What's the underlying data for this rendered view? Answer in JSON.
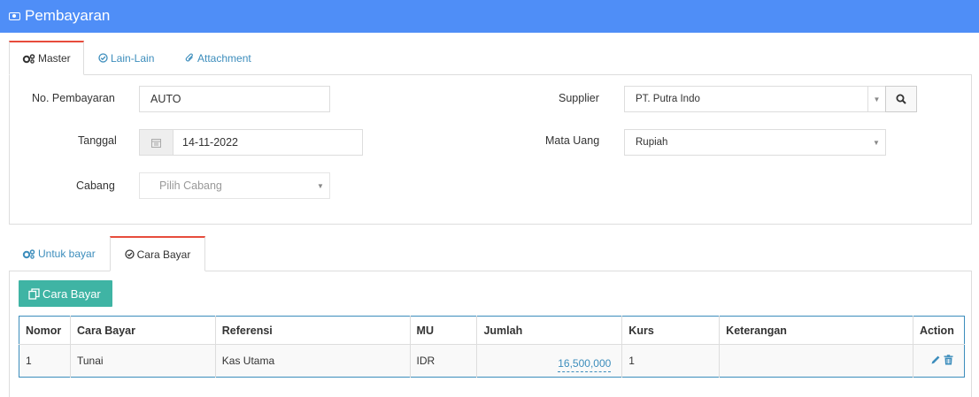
{
  "header": {
    "title": "Pembayaran",
    "icon": "money-icon"
  },
  "top_tabs": [
    {
      "label": "Master",
      "icon": "cogs-icon",
      "active": true
    },
    {
      "label": "Lain-Lain",
      "icon": "check-circle-icon",
      "active": false
    },
    {
      "label": "Attachment",
      "icon": "paperclip-icon",
      "active": false
    }
  ],
  "form": {
    "no_pembayaran": {
      "label": "No. Pembayaran",
      "value": "AUTO"
    },
    "tanggal": {
      "label": "Tanggal",
      "value": "14-11-2022"
    },
    "cabang": {
      "label": "Cabang",
      "placeholder": "Pilih Cabang"
    },
    "supplier": {
      "label": "Supplier",
      "value": "PT. Putra Indo"
    },
    "mata_uang": {
      "label": "Mata Uang",
      "value": "Rupiah"
    }
  },
  "bottom_tabs": [
    {
      "label": "Untuk bayar",
      "icon": "cogs-icon",
      "active": false
    },
    {
      "label": "Cara Bayar",
      "icon": "check-circle-icon",
      "active": true
    }
  ],
  "cara_bayar_button": {
    "label": "Cara Bayar",
    "icon": "copy-icon"
  },
  "table": {
    "columns": [
      "Nomor",
      "Cara Bayar",
      "Referensi",
      "MU",
      "Jumlah",
      "Kurs",
      "Keterangan",
      "Action"
    ],
    "rows": [
      {
        "nomor": "1",
        "cara_bayar": "Tunai",
        "referensi": "Kas Utama",
        "mu": "IDR",
        "jumlah": "16,500,000",
        "kurs": "1",
        "keterangan": ""
      }
    ]
  },
  "colors": {
    "header": "#4f8ef7",
    "accent_tab": "#e74c3c",
    "link": "#3c8dbc",
    "button": "#3fb4a4"
  }
}
